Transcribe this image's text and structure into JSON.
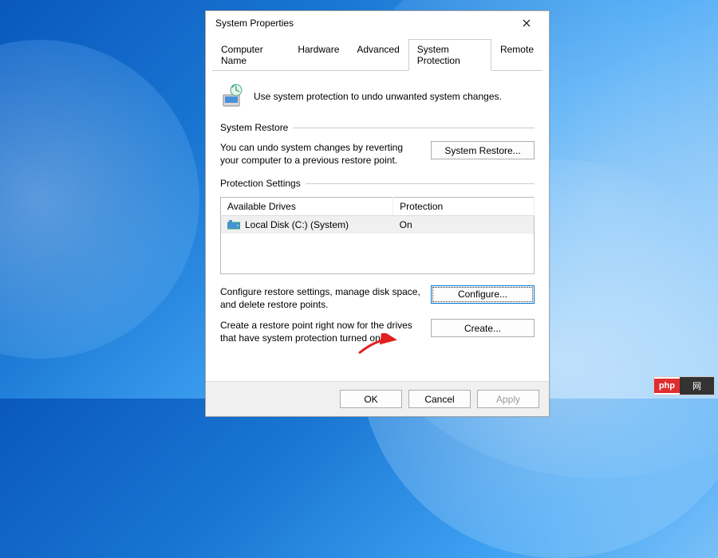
{
  "titlebar": {
    "title": "System Properties"
  },
  "tabs": [
    {
      "label": "Computer Name",
      "active": false
    },
    {
      "label": "Hardware",
      "active": false
    },
    {
      "label": "Advanced",
      "active": false
    },
    {
      "label": "System Protection",
      "active": true
    },
    {
      "label": "Remote",
      "active": false
    }
  ],
  "intro_text": "Use system protection to undo unwanted system changes.",
  "sections": {
    "restore": {
      "legend": "System Restore",
      "text": "You can undo system changes by reverting your computer to a previous restore point.",
      "button": "System Restore..."
    },
    "protection": {
      "legend": "Protection Settings",
      "columns": {
        "drives": "Available Drives",
        "protection": "Protection"
      },
      "rows": [
        {
          "drive": "Local Disk (C:) (System)",
          "protection": "On"
        }
      ],
      "configure_text": "Configure restore settings, manage disk space, and delete restore points.",
      "configure_button": "Configure...",
      "create_text": "Create a restore point right now for the drives that have system protection turned on.",
      "create_button": "Create..."
    }
  },
  "footer": {
    "ok": "OK",
    "cancel": "Cancel",
    "apply": "Apply"
  },
  "watermark": {
    "left": "php",
    "right": "网"
  }
}
